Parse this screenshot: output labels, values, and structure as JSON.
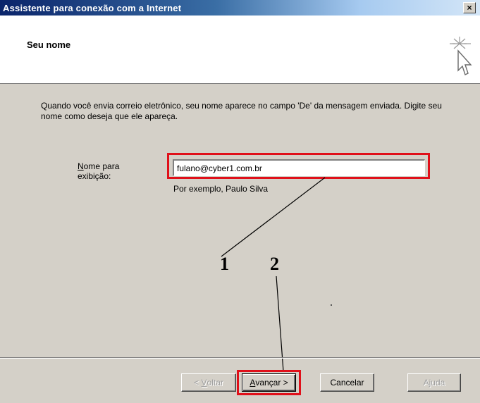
{
  "window": {
    "title": "Assistente para conexão com a Internet",
    "close_label": "×"
  },
  "header": {
    "title": "Seu nome",
    "icon": "wizard-cursor-icon"
  },
  "intro": {
    "text": "Quando você envia correio eletrônico, seu nome aparece no campo 'De' da mensagem enviada. Digite seu nome como deseja que ele apareça."
  },
  "form": {
    "label_first_letter": "N",
    "label_rest_line1": "ome para",
    "label_line2": "exibição:",
    "value": "fulano@cyber1.com.br",
    "hint": "Por exemplo, Paulo Silva"
  },
  "annotations": {
    "marker_1": "1",
    "marker_2": "2",
    "highlight_color": "#e0101a"
  },
  "buttons": {
    "back_prefix": "< ",
    "back_accel": "V",
    "back_rest": "oltar",
    "next_accel": "A",
    "next_rest": "vançar >",
    "cancel": "Cancelar",
    "help": "Ajuda"
  }
}
